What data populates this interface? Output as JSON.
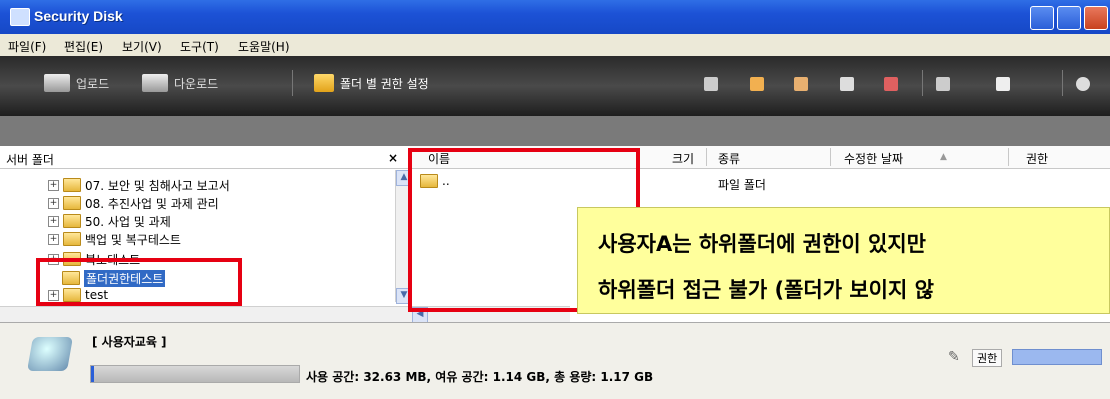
{
  "window": {
    "title": "Security Disk"
  },
  "menu": [
    "파일(F)",
    "편집(E)",
    "보기(V)",
    "도구(T)",
    "도움말(H)"
  ],
  "toolbar": {
    "upload_label": "업로드",
    "download_label": "다운로드",
    "folder_permission_label": "폴더 별 권한 설정"
  },
  "left_pane": {
    "header": "서버 폴더",
    "close_glyph": "×",
    "tree": [
      {
        "label": "07. 보안 및 침해사고 보고서"
      },
      {
        "label": "08. 추진사업 및 과제 관리"
      },
      {
        "label": "50. 사업 및 과제"
      },
      {
        "label": "백업 및 복구테스트"
      },
      {
        "label": "복노테스트"
      },
      {
        "label": "폴더권한테스트"
      },
      {
        "label": "test"
      }
    ]
  },
  "right_pane": {
    "columns": {
      "name": "이름",
      "size": "크기",
      "type": "종류",
      "modified": "수정한 날짜",
      "permission": "권한"
    },
    "sort_glyph": "▲",
    "rows": [
      {
        "name": "..",
        "type": "파일 폴더"
      }
    ]
  },
  "callout": {
    "line1": "사용자A는 하위폴더에 권한이 있지만",
    "line2": "하위폴더 접근 불가 (폴더가 보이지 않"
  },
  "status": {
    "user_label": "[ 사용자교육 ]",
    "usage_text": "사용 공간: 32.63 MB,  여유 공간: 1.14 GB,  총 용량: 1.17 GB",
    "permission_label": "권한"
  },
  "colors": {
    "highlight_red": "#e60012",
    "callout_bg": "#ffff9c",
    "selection": "#316ac5"
  }
}
